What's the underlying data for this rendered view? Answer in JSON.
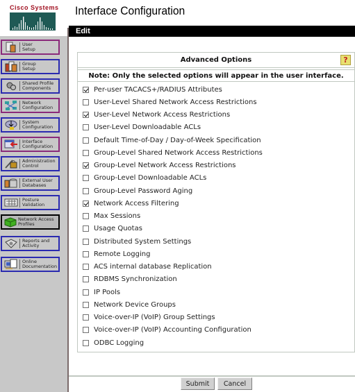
{
  "brand": {
    "name": "Cisco Systems",
    "accent_color": "#a01020"
  },
  "header": {
    "title": "Interface Configuration",
    "section": "Edit"
  },
  "nav": {
    "items": [
      {
        "label": "User\nSetup",
        "icon": "user-setup-icon",
        "border": "purple"
      },
      {
        "label": "Group\nSetup",
        "icon": "group-setup-icon",
        "border": "blue"
      },
      {
        "label": "Shared Profile\nComponents",
        "icon": "shared-profile-icon",
        "border": "blue"
      },
      {
        "label": "Network\nConfiguration",
        "icon": "network-config-icon",
        "border": "purple"
      },
      {
        "label": "System\nConfiguration",
        "icon": "system-config-icon",
        "border": "blue"
      },
      {
        "label": "Interface\nConfiguration",
        "icon": "interface-config-icon",
        "border": "purple"
      },
      {
        "label": "Administration\nControl",
        "icon": "admin-control-icon",
        "border": "blue"
      },
      {
        "label": "External User\nDatabases",
        "icon": "external-db-icon",
        "border": "blue"
      },
      {
        "label": "Posture\nValidation",
        "icon": "posture-validation-icon",
        "border": "blue"
      },
      {
        "label": "Network Access\nProfiles",
        "icon": "network-access-profiles-icon",
        "border": "active"
      },
      {
        "label": "Reports and\nActivity",
        "icon": "reports-icon",
        "border": "blue"
      },
      {
        "label": "Online\nDocumentation",
        "icon": "documentation-icon",
        "border": "blue"
      }
    ]
  },
  "panel": {
    "title": "Advanced Options",
    "help_icon": "?",
    "note": "Note: Only the selected options will appear in the user interface.",
    "options": [
      {
        "label": "Per-user TACACS+/RADIUS Attributes",
        "checked": true
      },
      {
        "label": "User-Level Shared Network Access Restrictions",
        "checked": false
      },
      {
        "label": "User-Level Network Access Restrictions",
        "checked": true
      },
      {
        "label": "User-Level Downloadable ACLs",
        "checked": false
      },
      {
        "label": "Default Time-of-Day / Day-of-Week Specification",
        "checked": false
      },
      {
        "label": "Group-Level Shared Network Access Restrictions",
        "checked": false
      },
      {
        "label": "Group-Level Network Access Restrictions",
        "checked": true
      },
      {
        "label": "Group-Level Downloadable ACLs",
        "checked": false
      },
      {
        "label": "Group-Level Password Aging",
        "checked": false
      },
      {
        "label": "Network Access Filtering",
        "checked": true
      },
      {
        "label": "Max Sessions",
        "checked": false
      },
      {
        "label": "Usage Quotas",
        "checked": false
      },
      {
        "label": "Distributed System Settings",
        "checked": false
      },
      {
        "label": "Remote Logging",
        "checked": false
      },
      {
        "label": "ACS internal database Replication",
        "checked": false
      },
      {
        "label": "RDBMS Synchronization",
        "checked": false
      },
      {
        "label": "IP Pools",
        "checked": false
      },
      {
        "label": "Network Device Groups",
        "checked": false
      },
      {
        "label": "Voice-over-IP (VoIP) Group Settings",
        "checked": false
      },
      {
        "label": "Voice-over-IP (VoIP) Accounting Configuration",
        "checked": false
      },
      {
        "label": "ODBC Logging",
        "checked": false
      }
    ]
  },
  "actions": {
    "submit": "Submit",
    "cancel": "Cancel"
  }
}
